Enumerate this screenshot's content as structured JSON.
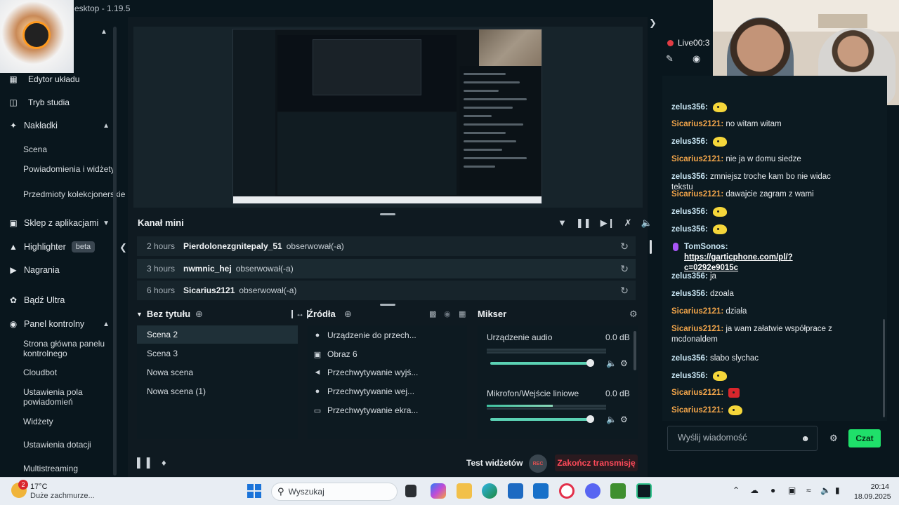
{
  "window": {
    "title": "esktop - 1.19.5"
  },
  "sidebar": {
    "items": [
      {
        "label": "Edytor układu",
        "icon": "layout-icon"
      },
      {
        "label": "Tryb studia",
        "icon": "studio-icon"
      },
      {
        "label": "Nakładki",
        "icon": "overlay-icon"
      },
      {
        "label": "Scena"
      },
      {
        "label": "Powiadomienia i widżety"
      },
      {
        "label": "Przedmioty kolekcjonerskie"
      },
      {
        "label": "Sklep z aplikacjami",
        "icon": "store-icon"
      },
      {
        "label": "Highlighter",
        "icon": "highlighter-icon",
        "badge": "beta"
      },
      {
        "label": "Nagrania",
        "icon": "record-icon"
      },
      {
        "label": "Bądź Ultra",
        "icon": "ultra-icon"
      },
      {
        "label": "Panel kontrolny",
        "icon": "dashboard-icon"
      },
      {
        "label": "Strona główna panelu kontrolnego"
      },
      {
        "label": "Cloudbot"
      },
      {
        "label": "Ustawienia pola powiadomień"
      },
      {
        "label": "Widżety"
      },
      {
        "label": "Ustawienia dotacji"
      },
      {
        "label": "Multistreaming"
      }
    ]
  },
  "mini_feed": {
    "title": "Kanał mini",
    "rows": [
      {
        "time": "2 hours",
        "user": "Pierdolonezgnitepaly_51",
        "action": "obserwował(-a)"
      },
      {
        "time": "3 hours",
        "user": "nwmnic_hej",
        "action": "obserwował(-a)"
      },
      {
        "time": "6 hours",
        "user": "Sicarius2121",
        "action": "obserwował(-a)"
      }
    ]
  },
  "scenes": {
    "title": "Bez tytułu",
    "items": [
      "Scena 2",
      "Scena 3",
      "Nowa scena",
      "Nowa scena (1)"
    ],
    "selected": "Scena 2"
  },
  "sources": {
    "title": "Źródła",
    "items": [
      {
        "label": "Urządzenie do przech...",
        "icon": "webcam-icon"
      },
      {
        "label": "Obraz 6",
        "icon": "image-icon"
      },
      {
        "label": "Przechwytywanie wyjś...",
        "icon": "speaker-icon"
      },
      {
        "label": "Przechwytywanie wej...",
        "icon": "mic-icon"
      },
      {
        "label": "Przechwytywanie ekra...",
        "icon": "monitor-icon"
      }
    ]
  },
  "mixer": {
    "title": "Mikser",
    "channels": [
      {
        "name": "Urządzenie audio",
        "db": "0.0 dB",
        "level": 0.0,
        "volume": 1.0
      },
      {
        "name": "Mikrofon/Wejście liniowe",
        "db": "0.0 dB",
        "level": 0.55,
        "volume": 1.0
      }
    ]
  },
  "footer": {
    "test_widgets": "Test widżetów",
    "rec": "REC",
    "end_stream": "Zakończ transmisję"
  },
  "live": {
    "label": "Live",
    "timer": "00:3"
  },
  "chat": {
    "messages": [
      {
        "user": "zelus356",
        "type": "z",
        "text": "",
        "emote": "yellow"
      },
      {
        "user": "Sicarius2121",
        "type": "s",
        "text": "no witam witam"
      },
      {
        "user": "zelus356",
        "type": "z",
        "text": "",
        "emote": "yellow"
      },
      {
        "user": "Sicarius2121",
        "type": "s",
        "text": "nie ja w domu siedze"
      },
      {
        "user": "zelus356",
        "type": "z",
        "text": "zmniejsz troche kam bo nie widac tekstu"
      },
      {
        "user": "Sicarius2121",
        "type": "s",
        "text": "dawajcie zagram z wami"
      },
      {
        "user": "zelus356",
        "type": "z",
        "text": "",
        "emote": "yellow"
      },
      {
        "user": "zelus356",
        "type": "z",
        "text": "",
        "emote": "yellow"
      },
      {
        "user": "TomSonos",
        "type": "t",
        "text": "",
        "link": "https://garticphone.com/pl/?c=0292e9015c"
      },
      {
        "user": "zelus356",
        "type": "z",
        "text": "ja"
      },
      {
        "user": "zelus356",
        "type": "z",
        "text": "dzoala"
      },
      {
        "user": "Sicarius2121",
        "type": "s",
        "text": "działa"
      },
      {
        "user": "Sicarius2121",
        "type": "s",
        "text": "ja wam załatwie współprace z mcdonaldem"
      },
      {
        "user": "zelus356",
        "type": "z",
        "text": "slabo slychac"
      },
      {
        "user": "zelus356",
        "type": "z",
        "text": "",
        "emote": "yellow"
      },
      {
        "user": "Sicarius2121",
        "type": "s",
        "text": "",
        "emote": "red"
      },
      {
        "user": "Sicarius2121",
        "type": "s",
        "text": "",
        "emote": "yellow"
      }
    ],
    "input_placeholder": "Wyślij wiadomość",
    "send_label": "Czat"
  },
  "taskbar": {
    "weather": {
      "temp": "17°C",
      "desc": "Duże zachmurze...",
      "badge": "2"
    },
    "search_placeholder": "Wyszukaj",
    "time": "20:14",
    "date": "18.09.2025"
  }
}
